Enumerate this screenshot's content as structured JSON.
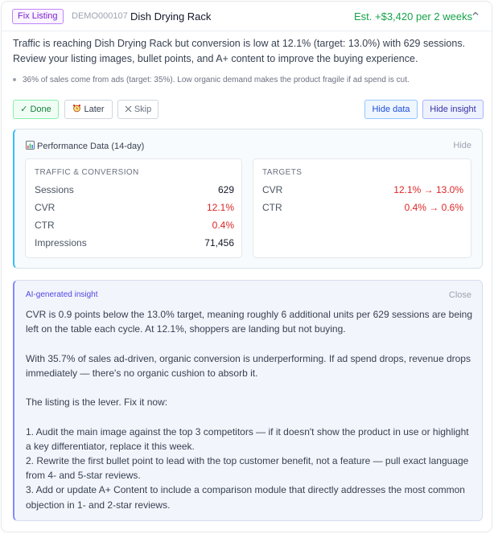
{
  "header": {
    "badge": "Fix Listing",
    "demo_id": "DEMO000107",
    "product": "Dish Drying Rack",
    "estimate": "Est. +$3,420 per 2 weeks",
    "collapse_icon": "chevron-up-icon"
  },
  "summary": "Traffic is reaching Dish Drying Rack but conversion is low at 12.1% (target: 13.0%) with 629 sessions. Review your listing images, bullet points, and A+ content to improve the buying experience.",
  "note": "36% of sales come from ads (target: 35%). Low organic demand makes the product fragile if ad spend is cut.",
  "actions": {
    "done": "✓ Done",
    "later": "Later",
    "skip": "Skip",
    "hide_data": "Hide data",
    "hide_insight": "Hide insight"
  },
  "performance": {
    "title": "Performance Data (14-day)",
    "hide": "Hide",
    "traffic": {
      "heading": "TRAFFIC & CONVERSION",
      "rows": [
        {
          "label": "Sessions",
          "value": "629"
        },
        {
          "label": "CVR",
          "value": "12.1%"
        },
        {
          "label": "CTR",
          "value": "0.4%"
        },
        {
          "label": "Impressions",
          "value": "71,456"
        }
      ]
    },
    "targets": {
      "heading": "TARGETS",
      "rows": [
        {
          "label": "CVR",
          "value": "12.1% → 13.0%"
        },
        {
          "label": "CTR",
          "value": "0.4% → 0.6%"
        }
      ]
    }
  },
  "insight": {
    "title": "AI-generated insight",
    "close": "Close",
    "paragraphs": [
      "CVR is 0.9 points below the 13.0% target, meaning roughly 6 additional units per 629 sessions are being left on the table each cycle. At 12.1%, shoppers are landing but not buying.",
      "With 35.7% of sales ad-driven, organic conversion is underperforming. If ad spend drops, revenue drops immediately — there's no organic cushion to absorb it.",
      "The listing is the lever. Fix it now:",
      "1. Audit the main image against the top 3 competitors — if it doesn't show the product in use or highlight a key differentiator, replace it this week.",
      "2. Rewrite the first bullet point to lead with the top customer benefit, not a feature — pull exact language from 4- and 5-star reviews.",
      "3. Add or update A+ Content to include a comparison module that directly addresses the most common objection in 1- and 2-star reviews."
    ]
  },
  "colors": {
    "accent_green": "#16a34a",
    "badge_purple": "#7e22ce",
    "danger_red": "#dc2626",
    "insight_indigo": "#4f46e5"
  }
}
